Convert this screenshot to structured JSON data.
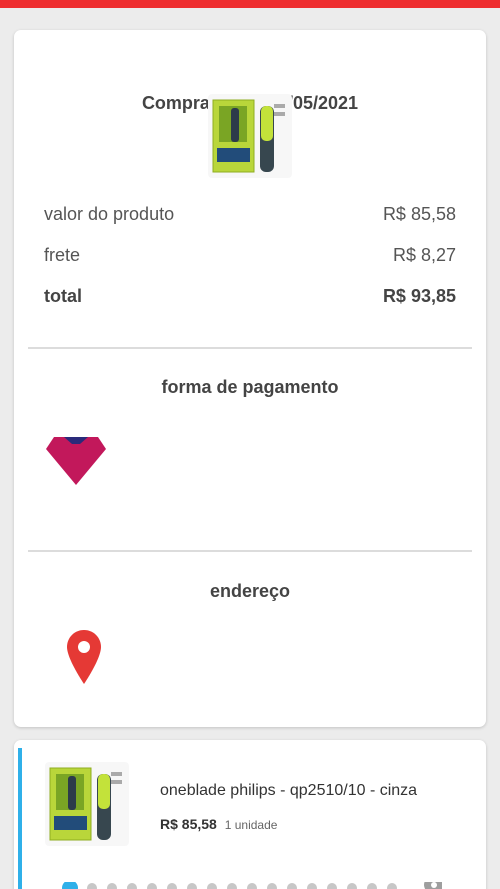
{
  "colors": {
    "header_red": "#ee2d2f",
    "payment_icon": "#c2185b",
    "payment_icon_top": "#2a2a7a",
    "pin_red": "#e53935",
    "accent_blue": "#2fb0e9"
  },
  "order_summary": {
    "purchase_date": "Comprado dia 04/05/2021",
    "product_image_icon": "product-photo",
    "rows": [
      {
        "label": "valor do produto",
        "value": "R$ 85,58"
      },
      {
        "label": "frete",
        "value": "R$ 8,27"
      }
    ],
    "total": {
      "label": "total",
      "value": "R$ 93,85"
    }
  },
  "payment": {
    "title": "forma de pagamento",
    "icon": "pix-like-diamond-icon"
  },
  "address": {
    "title": "endereço",
    "icon": "map-pin-icon"
  },
  "order_item": {
    "name": "oneblade philips - qp2510/10 - cinza",
    "price": "R$ 85,58",
    "quantity": "1 unidade"
  }
}
